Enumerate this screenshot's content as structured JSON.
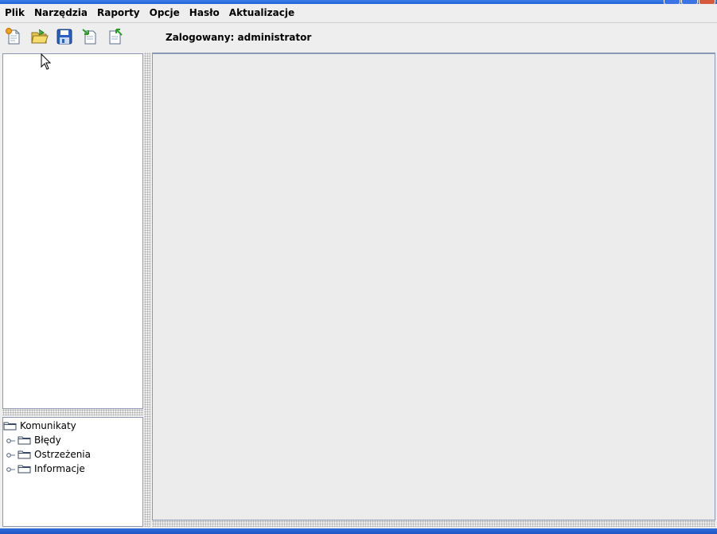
{
  "menubar": {
    "items": [
      {
        "label": "Plik"
      },
      {
        "label": "Narzędzia"
      },
      {
        "label": "Raporty"
      },
      {
        "label": "Opcje"
      },
      {
        "label": "Hasło"
      },
      {
        "label": "Aktualizacje"
      }
    ]
  },
  "toolbar": {
    "buttons": [
      {
        "icon": "new-file-icon"
      },
      {
        "icon": "open-folder-icon"
      },
      {
        "icon": "save-icon"
      },
      {
        "icon": "import-icon"
      },
      {
        "icon": "export-icon"
      }
    ],
    "status_label": "Zalogowany: administrator"
  },
  "tree": {
    "root": {
      "label": "Komunikaty",
      "icon": "folder-icon"
    },
    "children": [
      {
        "label": "Błędy",
        "icon": "folder-icon"
      },
      {
        "label": "Ostrzeżenia",
        "icon": "folder-icon"
      },
      {
        "label": "Informacje",
        "icon": "folder-icon"
      }
    ]
  },
  "colors": {
    "menubar_bg": "#eeeeee",
    "panel_border": "#8a99b5",
    "titlebar_blue": "#2462d6",
    "content_bg": "#ececec"
  }
}
